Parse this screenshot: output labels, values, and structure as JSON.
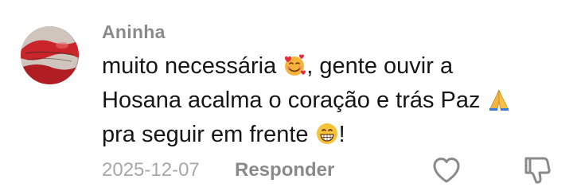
{
  "comment": {
    "username": "Aninha",
    "text_line1_before_emoji": "muito necessária ",
    "emoji1": "smiling-face-with-hearts-icon",
    "text_line1_after_emoji": ", gente ouvir a",
    "text_line2_before_emoji": "Hosana acalma o coração e trás Paz ",
    "emoji2": "folded-hands-icon",
    "text_line3_before_emoji": "pra seguir em frente ",
    "emoji3": "grinning-face-icon",
    "text_line3_after_emoji": "!",
    "date": "2025-12-07",
    "reply_label": "Responder"
  },
  "colors": {
    "username": "#8a8a8a",
    "text": "#161616",
    "meta": "#a8a8a8",
    "icon": "#8a8a8a"
  }
}
